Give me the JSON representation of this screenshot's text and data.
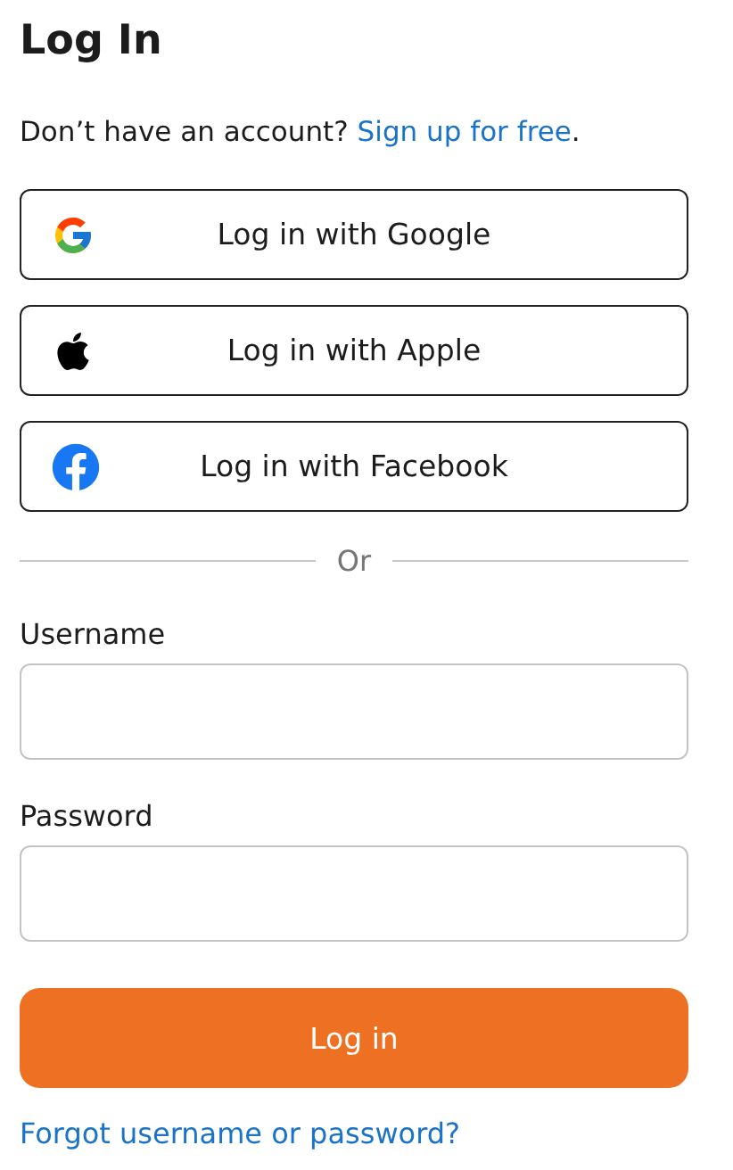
{
  "title": "Log In",
  "signup_prompt": {
    "text": "Don’t have an account?",
    "link": "Sign up for free",
    "suffix": "."
  },
  "social_buttons": [
    {
      "kind": "google",
      "label": "Log in with Google"
    },
    {
      "kind": "apple",
      "label": "Log in with Apple"
    },
    {
      "kind": "facebook",
      "label": "Log in with Facebook"
    }
  ],
  "divider": "Or",
  "fields": [
    {
      "label": "Username"
    },
    {
      "label": "Password"
    }
  ],
  "submit": "Log in",
  "forgot_link": "Forgot username or password?"
}
